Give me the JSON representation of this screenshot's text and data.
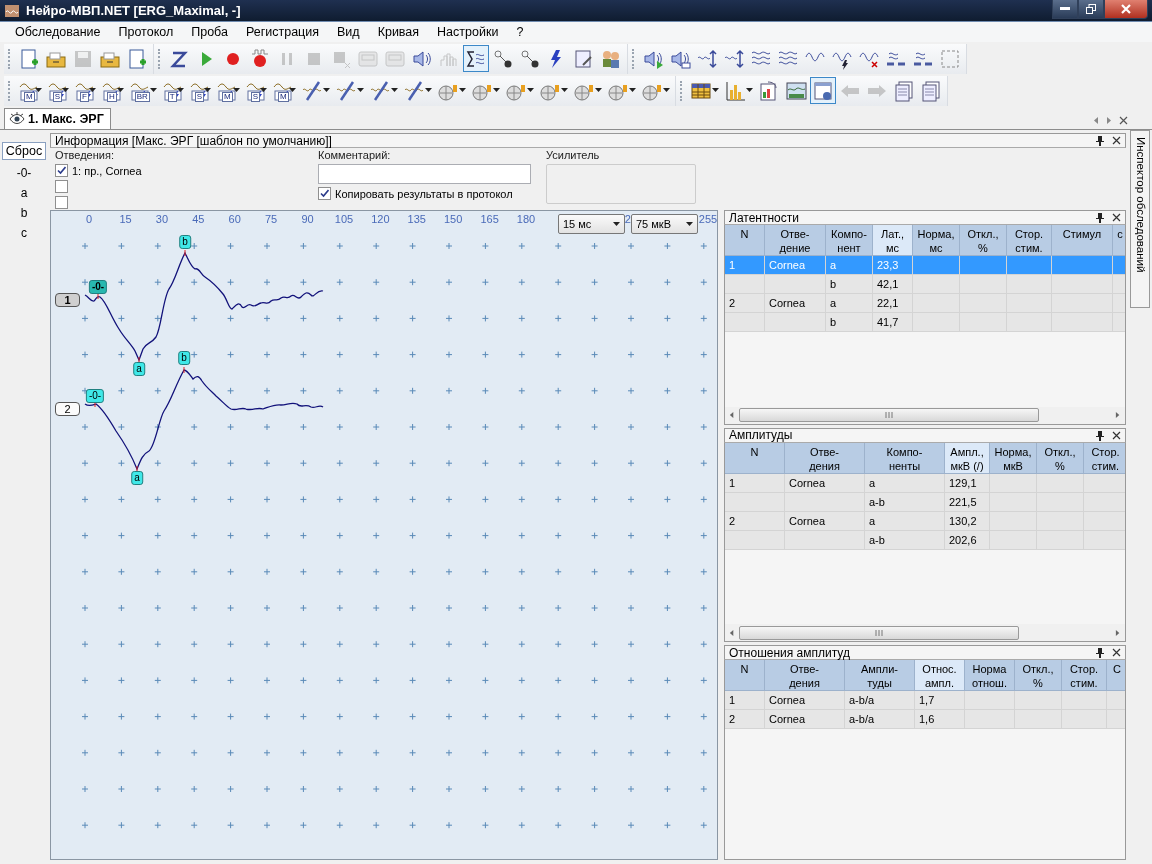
{
  "window": {
    "title": "Нейро-МВП.NET [ERG_Maximal, -]"
  },
  "menu": [
    "Обследование",
    "Протокол",
    "Проба",
    "Регистрация",
    "Вид",
    "Кривая",
    "Настройки",
    "?"
  ],
  "toolbar_rows": [
    {
      "groups": [
        {
          "items": [
            {
              "kind": "new",
              "disabled": false,
              "pressed": false
            },
            {
              "kind": "open",
              "disabled": false,
              "pressed": false
            },
            {
              "kind": "save",
              "disabled": true,
              "pressed": false
            },
            {
              "kind": "export",
              "disabled": false,
              "pressed": false
            },
            {
              "kind": "page",
              "disabled": false,
              "pressed": false
            }
          ]
        },
        {
          "items": [
            {
              "kind": "z",
              "disabled": false,
              "pressed": false
            },
            {
              "kind": "play",
              "disabled": false,
              "pressed": false
            },
            {
              "kind": "record",
              "disabled": false,
              "pressed": false
            },
            {
              "kind": "pulse",
              "disabled": false,
              "pressed": false
            },
            {
              "kind": "pause",
              "disabled": true,
              "pressed": false
            },
            {
              "kind": "stop",
              "disabled": true,
              "pressed": false
            },
            {
              "kind": "cancel",
              "disabled": true,
              "pressed": false
            },
            {
              "kind": "tape",
              "disabled": true,
              "pressed": false
            },
            {
              "kind": "tape",
              "disabled": true,
              "pressed": false
            },
            {
              "kind": "speaker",
              "disabled": false,
              "pressed": false
            },
            {
              "kind": "bars",
              "disabled": true,
              "pressed": false
            },
            {
              "kind": "sigma",
              "disabled": false,
              "pressed": true
            },
            {
              "kind": "probe",
              "disabled": false,
              "pressed": false
            },
            {
              "kind": "electrode",
              "disabled": false,
              "pressed": false
            },
            {
              "kind": "bolt",
              "disabled": false,
              "pressed": false
            },
            {
              "kind": "tool",
              "disabled": false,
              "pressed": false
            },
            {
              "kind": "swap",
              "disabled": false,
              "pressed": false
            }
          ]
        },
        {
          "items": [
            {
              "kind": "playback",
              "disabled": false,
              "pressed": false
            },
            {
              "kind": "sound",
              "disabled": false,
              "pressed": false
            },
            {
              "kind": "shiftup",
              "disabled": false,
              "pressed": false
            },
            {
              "kind": "shiftdown",
              "disabled": false,
              "pressed": false
            },
            {
              "kind": "stack",
              "disabled": false,
              "pressed": false
            },
            {
              "kind": "overlay",
              "disabled": false,
              "pressed": false
            },
            {
              "kind": "sine",
              "disabled": false,
              "pressed": false
            },
            {
              "kind": "stimsine",
              "disabled": false,
              "pressed": false
            },
            {
              "kind": "remove",
              "disabled": false,
              "pressed": false
            },
            {
              "kind": "join",
              "disabled": false,
              "pressed": false
            },
            {
              "kind": "split",
              "disabled": false,
              "pressed": false
            },
            {
              "kind": "frame",
              "disabled": false,
              "pressed": false
            }
          ]
        }
      ]
    },
    {
      "groups": [
        {
          "items": [
            {
              "kind": "stim",
              "label": "M",
              "disabled": false,
              "pressed": false,
              "dropdown": true
            },
            {
              "kind": "stim",
              "label": "S",
              "disabled": false,
              "pressed": false,
              "dropdown": true
            },
            {
              "kind": "stim",
              "label": "F",
              "disabled": false,
              "pressed": false,
              "dropdown": true
            },
            {
              "kind": "stim",
              "label": "H",
              "disabled": false,
              "pressed": false,
              "dropdown": true
            },
            {
              "kind": "stim",
              "label": "BR",
              "disabled": false,
              "pressed": false,
              "dropdown": true
            },
            {
              "kind": "stim",
              "label": "T",
              "disabled": false,
              "pressed": false,
              "dropdown": true
            },
            {
              "kind": "stim",
              "label": "S",
              "disabled": false,
              "pressed": false,
              "dropdown": true
            },
            {
              "kind": "stim",
              "label": "M",
              "disabled": false,
              "pressed": false,
              "dropdown": true
            },
            {
              "kind": "stim",
              "label": "S",
              "disabled": false,
              "pressed": false,
              "dropdown": true
            },
            {
              "kind": "stim",
              "label": "M",
              "disabled": false,
              "pressed": false,
              "dropdown": true
            },
            {
              "kind": "slash",
              "disabled": false,
              "pressed": false,
              "dropdown": true
            },
            {
              "kind": "slash",
              "disabled": false,
              "pressed": false,
              "dropdown": true
            },
            {
              "kind": "slash",
              "disabled": false,
              "pressed": false,
              "dropdown": true
            },
            {
              "kind": "slash",
              "disabled": false,
              "pressed": false,
              "dropdown": true
            },
            {
              "kind": "brain",
              "disabled": false,
              "pressed": false,
              "dropdown": true
            },
            {
              "kind": "brain",
              "disabled": false,
              "pressed": false,
              "dropdown": true
            },
            {
              "kind": "brain",
              "disabled": false,
              "pressed": false,
              "dropdown": true
            },
            {
              "kind": "brain",
              "disabled": false,
              "pressed": false,
              "dropdown": true
            },
            {
              "kind": "brain",
              "disabled": false,
              "pressed": false,
              "dropdown": true
            },
            {
              "kind": "brain",
              "disabled": false,
              "pressed": false,
              "dropdown": true
            },
            {
              "kind": "brain",
              "disabled": false,
              "pressed": false,
              "dropdown": true
            }
          ]
        },
        {
          "items": [
            {
              "kind": "table",
              "disabled": false,
              "pressed": false,
              "dropdown": true
            },
            {
              "kind": "chart",
              "disabled": false,
              "pressed": false,
              "dropdown": true
            },
            {
              "kind": "report",
              "disabled": false,
              "pressed": false,
              "dropdown": false
            },
            {
              "kind": "monitor",
              "disabled": false,
              "pressed": false,
              "dropdown": false
            },
            {
              "kind": "info",
              "disabled": false,
              "pressed": true,
              "dropdown": false
            },
            {
              "kind": "back",
              "disabled": true,
              "pressed": false,
              "dropdown": false
            },
            {
              "kind": "forward",
              "disabled": true,
              "pressed": false,
              "dropdown": false
            },
            {
              "kind": "sheet",
              "disabled": false,
              "pressed": false,
              "dropdown": false
            },
            {
              "kind": "sheet",
              "disabled": false,
              "pressed": false,
              "dropdown": false
            }
          ]
        }
      ]
    }
  ],
  "document_tab": {
    "label": "1. Макс. ЭРГ",
    "selected": true
  },
  "marker_strip": {
    "reset": "Сброс",
    "markers": [
      "-0-",
      "a",
      "b",
      "c"
    ]
  },
  "info_panel": {
    "title": "Информация [Макс. ЭРГ [шаблон по умолчанию]]",
    "leads_label": "Отведения:",
    "leads": [
      {
        "label": "1: пр., Cornea",
        "checked": true
      },
      {
        "checked": false
      },
      {
        "checked": false
      }
    ],
    "comment_label": "Комментарий:",
    "copy_label": "Копировать результаты в протокол",
    "copy_checked": true,
    "amplifier_label": "Усилитель"
  },
  "plot": {
    "x_labels": [
      "0",
      "15",
      "30",
      "45",
      "60",
      "75",
      "90",
      "105",
      "120",
      "135",
      "150",
      "165",
      "180",
      "2",
      "255"
    ],
    "sweep": "15 мс",
    "sensitivity": "75 мкВ",
    "traces": [
      {
        "label": "1",
        "selected": true,
        "markers": [
          {
            "text": "-0-",
            "selected": true
          },
          {
            "text": "a",
            "selected": false
          },
          {
            "text": "b",
            "selected": false
          }
        ]
      },
      {
        "label": "2",
        "selected": false,
        "markers": [
          {
            "text": "-0-",
            "selected": false
          },
          {
            "text": "a",
            "selected": false
          },
          {
            "text": "b",
            "selected": false
          }
        ]
      }
    ]
  },
  "tables": [
    {
      "title": "Латентности",
      "columns": [
        {
          "header": "N",
          "highlighted": false
        },
        {
          "header": "Отве-\nдение",
          "highlighted": false
        },
        {
          "header": "Компо-\nнент",
          "highlighted": false
        },
        {
          "header": "Лат.,\nмс",
          "highlighted": true
        },
        {
          "header": "Норма,\nмс",
          "highlighted": false
        },
        {
          "header": "Откл.,\n%",
          "highlighted": false
        },
        {
          "header": "Стор.\nстим.",
          "highlighted": false
        },
        {
          "header": "Стимул",
          "highlighted": false
        },
        {
          "header": "с",
          "highlighted": false
        }
      ],
      "rows": [
        {
          "cells": [
            "1",
            "Cornea",
            "a",
            "23,3"
          ],
          "selected": true
        },
        {
          "cells": [
            null,
            null,
            "b",
            "42,1"
          ],
          "selected": false
        },
        {
          "cells": [
            "2",
            "Cornea",
            "a",
            "22,1"
          ],
          "selected": false
        },
        {
          "cells": [
            null,
            null,
            "b",
            "41,7"
          ],
          "selected": false
        }
      ]
    },
    {
      "title": "Амплитуды",
      "columns": [
        {
          "header": "N",
          "highlighted": false
        },
        {
          "header": "Отве-\nдения",
          "highlighted": false
        },
        {
          "header": "Компо-\nненты",
          "highlighted": false
        },
        {
          "header": "Ампл.,\nмкВ (/)",
          "highlighted": true
        },
        {
          "header": "Норма,\nмкВ",
          "highlighted": false
        },
        {
          "header": "Откл.,\n%",
          "highlighted": false
        },
        {
          "header": "Стор.\nстим.",
          "highlighted": false
        }
      ],
      "rows": [
        {
          "cells": [
            "1",
            "Cornea",
            "a",
            "129,1"
          ],
          "selected": false
        },
        {
          "cells": [
            null,
            null,
            "a-b",
            "221,5"
          ],
          "selected": false
        },
        {
          "cells": [
            "2",
            "Cornea",
            "a",
            "130,2"
          ],
          "selected": false
        },
        {
          "cells": [
            null,
            null,
            "a-b",
            "202,6"
          ],
          "selected": false
        }
      ]
    },
    {
      "title": "Отношения амплитуд",
      "columns": [
        {
          "header": "N",
          "highlighted": false
        },
        {
          "header": "Отве-\nдения",
          "highlighted": false
        },
        {
          "header": "Ампли-\nтуды",
          "highlighted": false
        },
        {
          "header": "Относ.\nампл.",
          "highlighted": true
        },
        {
          "header": "Норма\nотнош.",
          "highlighted": false
        },
        {
          "header": "Откл.,\n%",
          "highlighted": false
        },
        {
          "header": "Стор.\nстим.",
          "highlighted": false
        },
        {
          "header": "С",
          "highlighted": false
        }
      ],
      "rows": [
        {
          "cells": [
            "1",
            "Cornea",
            "a-b/a",
            "1,7"
          ],
          "selected": false
        },
        {
          "cells": [
            "2",
            "Cornea",
            "a-b/a",
            "1,6"
          ],
          "selected": false
        }
      ]
    }
  ],
  "side_tab": "Инспектор обследований"
}
